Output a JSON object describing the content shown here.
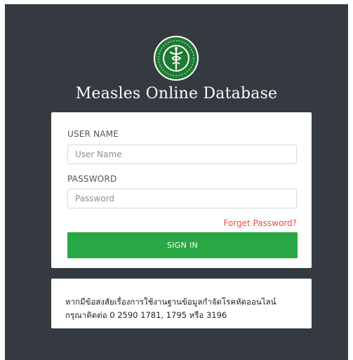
{
  "header": {
    "logo_icon": "ministry-of-public-health-seal",
    "app_title": "Measles Online Database"
  },
  "login": {
    "username_label": "USER NAME",
    "username_placeholder": "User Name",
    "username_value": "",
    "password_label": "PASSWORD",
    "password_placeholder": "Password",
    "password_value": "",
    "forgot_label": "Forget Password?",
    "signin_label": "SIGN IN"
  },
  "contact": {
    "line1": "หากมีข้อสงสัยเรื่องการใช้งานฐานข้อมูลกำจัดโรคหัดออนไลน์",
    "line2": "กรุณาติดต่อ 0 2590 1781, 1795 หรือ 3196"
  },
  "colors": {
    "background": "#343a40",
    "signin_button": "#28a745",
    "forgot_link": "#ee4a4a",
    "logo_green": "#1f7a34"
  }
}
